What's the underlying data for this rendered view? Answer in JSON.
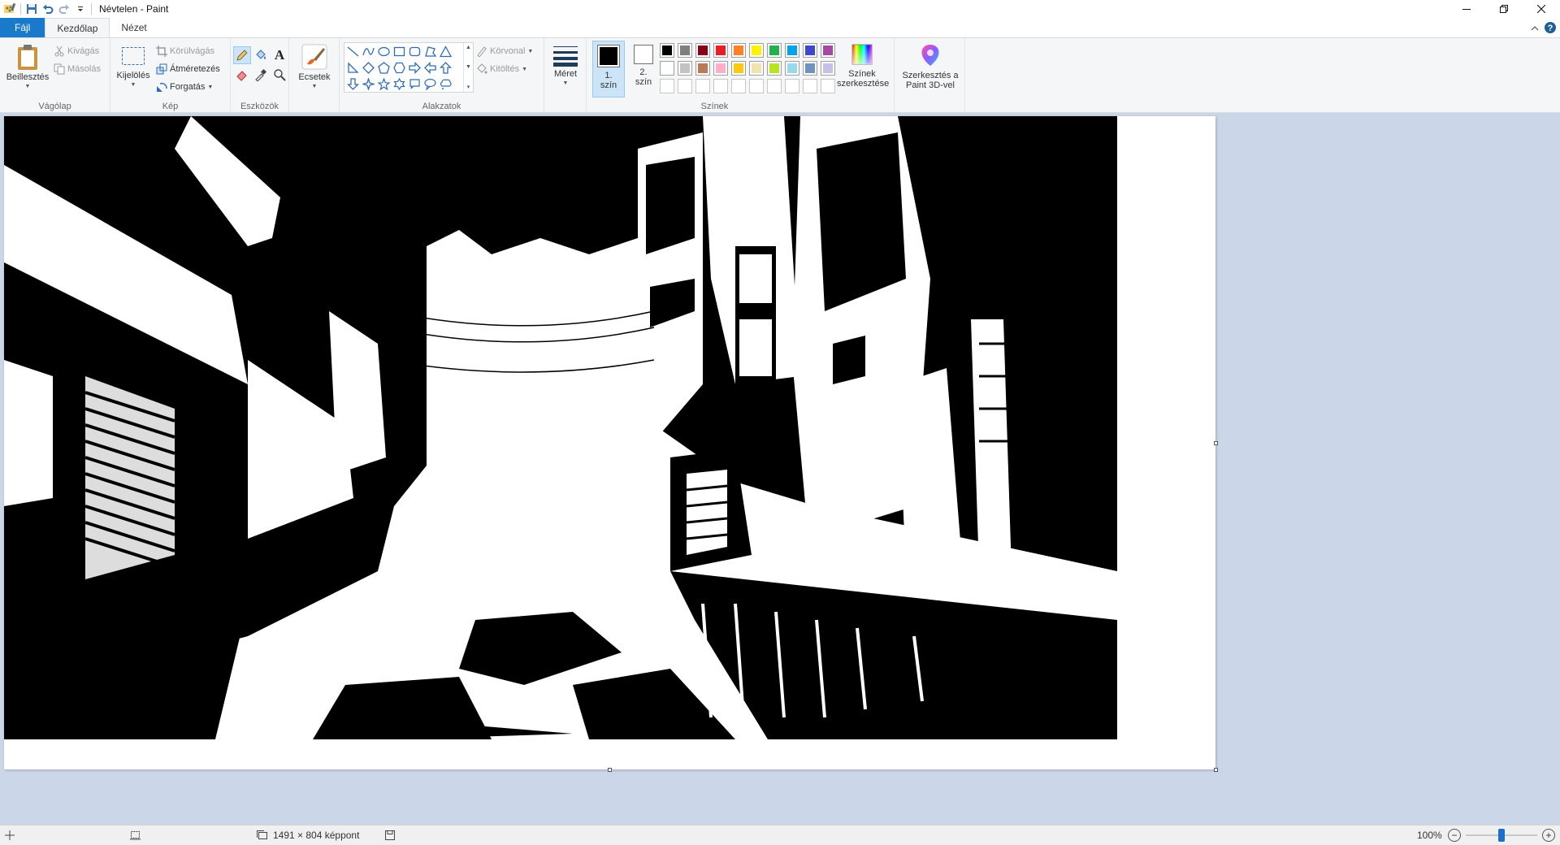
{
  "app": {
    "window_title": "Névtelen - Paint"
  },
  "tabs": [
    {
      "label": "Fájl"
    },
    {
      "label": "Kezdőlap"
    },
    {
      "label": "Nézet"
    }
  ],
  "ribbon": {
    "clipboard": {
      "group_label": "Vágólap",
      "paste": "Beillesztés",
      "cut": "Kivágás",
      "copy": "Másolás"
    },
    "image": {
      "group_label": "Kép",
      "select": "Kijelölés",
      "crop": "Körülvágás",
      "resize": "Átméretezés",
      "rotate": "Forgatás"
    },
    "tools": {
      "group_label": "Eszközök",
      "text_glyph": "A"
    },
    "brushes": {
      "label": "Ecsetek"
    },
    "shapes": {
      "group_label": "Alakzatok",
      "outline": "Körvonal",
      "fill": "Kitöltés"
    },
    "size": {
      "label": "Méret"
    },
    "colors": {
      "group_label": "Színek",
      "color1": "1. szín",
      "color2": "2. szín",
      "edit_colors": "Színek szerkesztése",
      "paint3d": "Szerkesztés a Paint 3D-vel",
      "color1_value": "#000000",
      "color2_value": "#ffffff",
      "palette_row1": [
        "#000000",
        "#7f7f7f",
        "#880015",
        "#ed1c24",
        "#ff7f27",
        "#fff200",
        "#22b14c",
        "#00a2e8",
        "#3f48cc",
        "#a349a4"
      ],
      "palette_row2": [
        "#ffffff",
        "#c3c3c3",
        "#b97a57",
        "#ffaec9",
        "#ffc90e",
        "#efe4b0",
        "#b5e61d",
        "#99d9ea",
        "#7092be",
        "#c8bfe7"
      ],
      "palette_row3": [
        "#ffffff",
        "#ffffff",
        "#ffffff",
        "#ffffff",
        "#ffffff",
        "#ffffff",
        "#ffffff",
        "#ffffff",
        "#ffffff",
        "#ffffff"
      ]
    }
  },
  "statusbar": {
    "image_size": "1491 × 804 képpont",
    "zoom": "100%",
    "zoom_level": 0.5
  }
}
